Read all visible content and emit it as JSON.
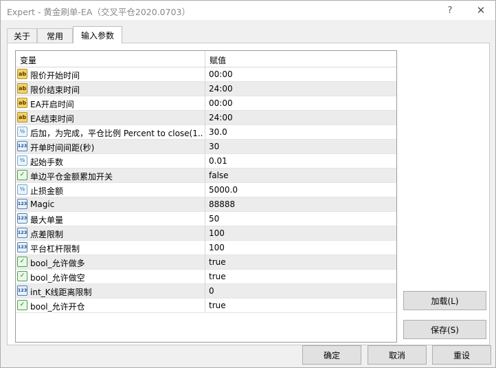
{
  "window": {
    "title": "Expert - 黄金刷单-EA（交叉平仓2020.0703）",
    "help_glyph": "?",
    "close_glyph": "✕"
  },
  "tabs": [
    {
      "label": "关于",
      "active": false
    },
    {
      "label": "常用",
      "active": false
    },
    {
      "label": "输入参数",
      "active": true
    }
  ],
  "grid": {
    "col_variable": "变量",
    "col_value": "赋值",
    "rows": [
      {
        "icon": "string-type-icon",
        "badge": "ab",
        "name": "限价开始时间",
        "value": "00:00"
      },
      {
        "icon": "string-type-icon",
        "badge": "ab",
        "name": "限价结束时间",
        "value": "24:00"
      },
      {
        "icon": "string-type-icon",
        "badge": "ab",
        "name": "EA开启时间",
        "value": "00:00"
      },
      {
        "icon": "string-type-icon",
        "badge": "ab",
        "name": "EA结束时间",
        "value": "24:00"
      },
      {
        "icon": "double-type-icon",
        "badge": "½",
        "name": "后加，为完成，平仓比例 Percent to close(1...",
        "value": "30.0"
      },
      {
        "icon": "integer-type-icon",
        "badge": "123",
        "name": "开单时间间距(秒)",
        "value": "30"
      },
      {
        "icon": "double-type-icon",
        "badge": "½",
        "name": "起始手数",
        "value": "0.01"
      },
      {
        "icon": "bool-type-icon",
        "badge": "✓",
        "name": "单边平仓金额累加开关",
        "value": "false"
      },
      {
        "icon": "double-type-icon",
        "badge": "½",
        "name": "止损金额",
        "value": "5000.0"
      },
      {
        "icon": "integer-type-icon",
        "badge": "123",
        "name": "Magic",
        "value": "88888"
      },
      {
        "icon": "integer-type-icon",
        "badge": "123",
        "name": "最大单量",
        "value": "50"
      },
      {
        "icon": "integer-type-icon",
        "badge": "123",
        "name": "点差限制",
        "value": "100"
      },
      {
        "icon": "integer-type-icon",
        "badge": "123",
        "name": "平台杠杆限制",
        "value": "100"
      },
      {
        "icon": "bool-type-icon",
        "badge": "✓",
        "name": "bool_允许做多",
        "value": "true"
      },
      {
        "icon": "bool-type-icon",
        "badge": "✓",
        "name": "bool_允许做空",
        "value": "true"
      },
      {
        "icon": "integer-type-icon",
        "badge": "123",
        "name": "int_K线距离限制",
        "value": "0"
      },
      {
        "icon": "bool-type-icon",
        "badge": "✓",
        "name": "bool_允许开仓",
        "value": "true"
      }
    ]
  },
  "buttons": {
    "load": "加载(L)",
    "save": "保存(S)",
    "ok": "确定",
    "cancel": "取消",
    "reset": "重设"
  }
}
